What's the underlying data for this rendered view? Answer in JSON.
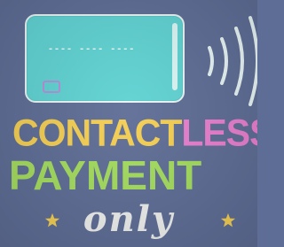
{
  "card": {
    "number_text": "---- ---- ----"
  },
  "headline": {
    "word1": "CONTACT",
    "word2": "LESS",
    "line2": "PAYMENT",
    "line3": "only"
  },
  "colors": {
    "background": "#5e6d96",
    "card": "#5fd3d3",
    "contact": "#f5cf52",
    "less": "#ea7fd0",
    "payment": "#a4dd5e",
    "only": "#eef0ee",
    "star": "#f5cf52",
    "waves": "#e9f6f5"
  },
  "icons": {
    "card": "credit-card-icon",
    "chip": "card-chip-icon",
    "contactless": "contactless-waves-icon",
    "star": "star-icon"
  }
}
